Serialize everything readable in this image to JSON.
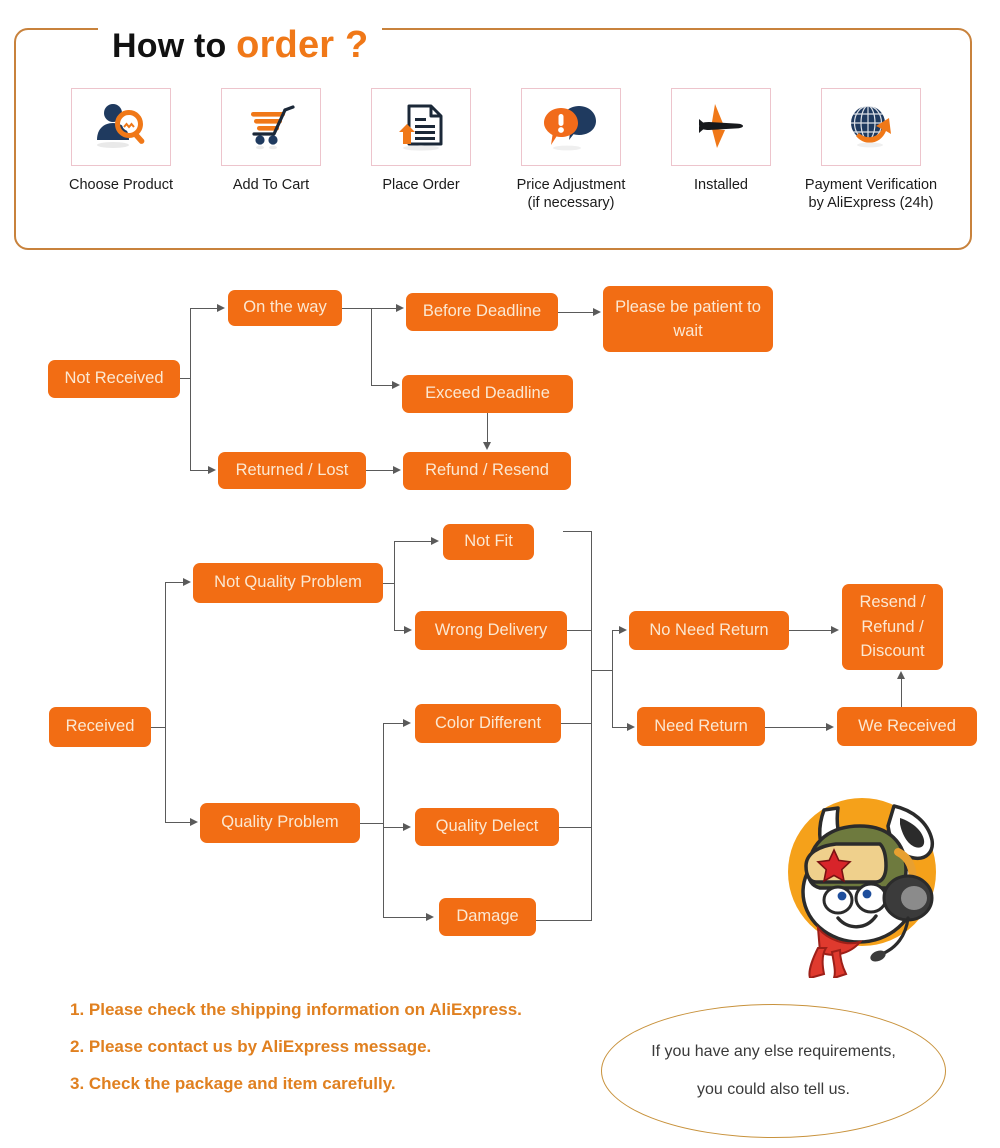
{
  "header": {
    "title_black": "How to ",
    "title_orange": "order ?",
    "border_color": "#C8823C",
    "accent_color": "#F07818"
  },
  "steps": [
    {
      "icon": "person-search-icon",
      "label": "Choose Product"
    },
    {
      "icon": "shopping-cart-icon",
      "label": "Add To Cart"
    },
    {
      "icon": "document-upload-icon",
      "label": "Place Order"
    },
    {
      "icon": "speech-bubbles-alert-icon",
      "label": "Price Adjustment\n(if necessary)"
    },
    {
      "icon": "airplane-icon",
      "label": "Installed"
    },
    {
      "icon": "globe-arrow-icon",
      "label": "Payment Verification\nby AliExpress (24h)"
    }
  ],
  "flow_not_received": {
    "root": "Not Received",
    "nodes": {
      "on_the_way": "On the way",
      "returned_lost": "Returned / Lost",
      "before_deadline": "Before Deadline",
      "exceed_deadline": "Exceed Deadline",
      "refund_resend": "Refund / Resend",
      "please_wait": "Please be patient to wait"
    }
  },
  "flow_received": {
    "root": "Received",
    "nodes": {
      "not_quality_problem": "Not Quality Problem",
      "quality_problem": "Quality Problem",
      "not_fit": "Not Fit",
      "wrong_delivery": "Wrong Delivery",
      "color_different": "Color Different",
      "quality_delect": "Quality Delect",
      "damage": "Damage",
      "no_need_return": "No Need Return",
      "need_return": "Need Return",
      "we_received": "We Received",
      "resend_refund_discount": "Resend / Refund / Discount"
    }
  },
  "notes": [
    "1. Please check the shipping information on AliExpress.",
    "2. Please contact us by AliExpress message.",
    "3. Check the package and item carefully."
  ],
  "oval": {
    "line1": "If you have any else requirements,",
    "line2": "you could also tell us."
  },
  "mascot": {
    "name": "xiaomi-mitu-headset-mascot"
  },
  "colors": {
    "box_orange": "#F26D14",
    "box_text": "#FBE8D2",
    "note_orange": "#E08020",
    "connector": "#5a5a5a",
    "icon_navy": "#1F3A5F",
    "icon_orange": "#F07818"
  }
}
